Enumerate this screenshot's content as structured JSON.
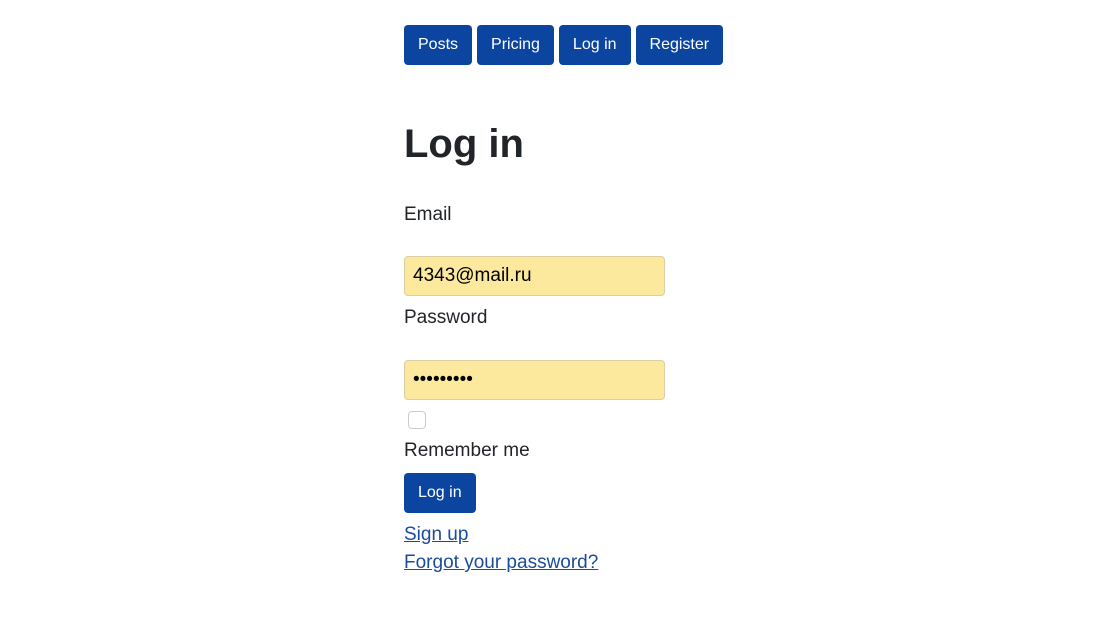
{
  "nav": {
    "items": [
      {
        "label": "Posts"
      },
      {
        "label": "Pricing"
      },
      {
        "label": "Log in"
      },
      {
        "label": "Register"
      }
    ]
  },
  "form": {
    "title": "Log in",
    "email_label": "Email",
    "email_value": "4343@mail.ru",
    "password_label": "Password",
    "password_value": "secretpwd",
    "remember_label": "Remember me",
    "remember_checked": false,
    "submit_label": "Log in"
  },
  "links": {
    "signup": "Sign up",
    "forgot": "Forgot your password?"
  },
  "colors": {
    "primary": "#0b45a0",
    "autofill": "#fde99d",
    "link": "#1a4b9c"
  }
}
